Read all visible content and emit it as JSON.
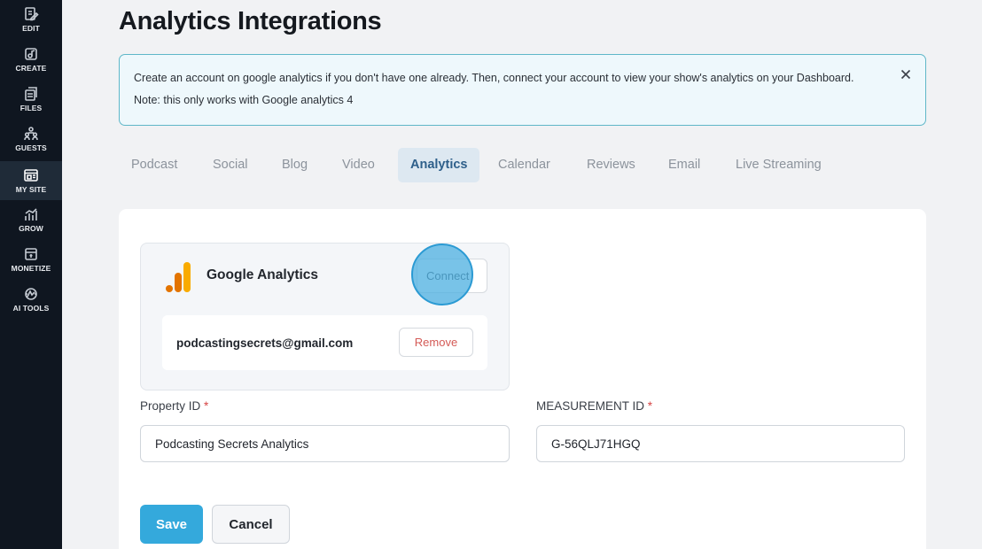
{
  "sidebar": {
    "items": [
      {
        "label": "EDIT",
        "icon": "edit-icon"
      },
      {
        "label": "CREATE",
        "icon": "create-icon"
      },
      {
        "label": "FILES",
        "icon": "files-icon"
      },
      {
        "label": "GUESTS",
        "icon": "guests-icon"
      },
      {
        "label": "MY SITE",
        "icon": "site-icon",
        "active": true
      },
      {
        "label": "GROW",
        "icon": "grow-icon"
      },
      {
        "label": "MONETIZE",
        "icon": "monetize-icon"
      },
      {
        "label": "AI TOOLS",
        "icon": "ai-tools-icon"
      }
    ]
  },
  "page": {
    "title": "Analytics Integrations"
  },
  "info": {
    "line1": "Create an account on google analytics if you don't have one already. Then, connect your account to view your show's analytics on your Dashboard.",
    "line2": "Note: this only works with Google analytics 4"
  },
  "tabs": [
    {
      "label": "Podcast"
    },
    {
      "label": "Social"
    },
    {
      "label": "Blog"
    },
    {
      "label": "Video"
    },
    {
      "label": "Analytics",
      "active": true
    },
    {
      "label": "Calendar"
    },
    {
      "label": "Reviews"
    },
    {
      "label": "Email"
    },
    {
      "label": "Live Streaming"
    }
  ],
  "integration": {
    "name": "Google Analytics",
    "connect_label": "Connect",
    "account_email": "podcastingsecrets@gmail.com",
    "remove_label": "Remove"
  },
  "form": {
    "property_id": {
      "label": "Property ID",
      "required": "*",
      "value": "Podcasting Secrets Analytics"
    },
    "measurement_id": {
      "label": "MEASUREMENT ID",
      "required": "*",
      "value": "G-56QLJ71HGQ"
    }
  },
  "actions": {
    "save_label": "Save",
    "cancel_label": "Cancel"
  },
  "colors": {
    "accent": "#34a9dc",
    "sidebar_bg": "#0f1620",
    "danger": "#d45a56",
    "info_border": "#5fb7c8"
  }
}
